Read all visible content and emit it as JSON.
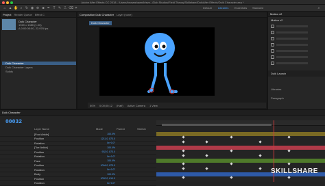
{
  "window": {
    "title": "Adobe After Effects CC 2018 - /Users/brownshawn/bhwn.../Dub Studios/Field Theory/Skillshare/DuikAfter Effects/Duik Character.aep *"
  },
  "workspaces": [
    "Default",
    "Libraries",
    "Essentials",
    "Standard"
  ],
  "workspace_active": "Essentials",
  "colors": {
    "accent": "#4aa3ff",
    "character": "#4aa3ff",
    "playhead": "#d23b3b",
    "skillshare_brand": "#ffffff"
  },
  "project": {
    "tab": "Project",
    "tab2": "Render Queue",
    "tab3": "Effect C",
    "comp_name": "Duik Character",
    "comp_info": "1920 x 1080 (1.00)",
    "comp_info2": "Δ 0:00:05:00, 23.976 fps",
    "items": [
      "Duik Character",
      "Duik Character Layers",
      "Solids"
    ]
  },
  "composition": {
    "tab": "Composition Duik Character",
    "tab2": "Layer (none)",
    "label": "Duik Character",
    "bar": [
      "50%",
      "0;00;00;12",
      "(Half)",
      "Active Camera",
      "1 View"
    ]
  },
  "right_panel": {
    "title1": "Motion v2",
    "title2": "Tools",
    "items": [
      "Duik Launch",
      "Libraries",
      "Paragraph"
    ],
    "duik_tab": "Duik Launch"
  },
  "timeline": {
    "tab": "Duik Character",
    "timecode": "00032",
    "columns": [
      "Layer Name",
      "Mode",
      "Parent",
      "Stretch"
    ],
    "rows": [
      {
        "name": "[Foot Ankle]",
        "value": "100.0%"
      },
      {
        "name": "Position",
        "value": "1211.0, 873.0"
      },
      {
        "name": "Rotation",
        "value": "0x+0.0°"
      },
      {
        "name": "[Toe Ankle]",
        "value": "100.0%"
      },
      {
        "name": "Position",
        "value": "932.0, 873.0"
      },
      {
        "name": "Rotation",
        "value": "0x+0.0°"
      },
      {
        "name": "Face",
        "value": "100.0%"
      },
      {
        "name": "Position",
        "value": "1004.0, 873.0"
      },
      {
        "name": "Rotation",
        "value": "0x+0.0°"
      },
      {
        "name": "Body",
        "value": "100.0%"
      },
      {
        "name": "Position",
        "value": "1020.0, 610.0"
      },
      {
        "name": "Rotation",
        "value": "0x+0.0°"
      }
    ],
    "parents": [
      "None",
      "None",
      "4. Body",
      "None"
    ]
  },
  "watermark": "SKILLSHARE"
}
